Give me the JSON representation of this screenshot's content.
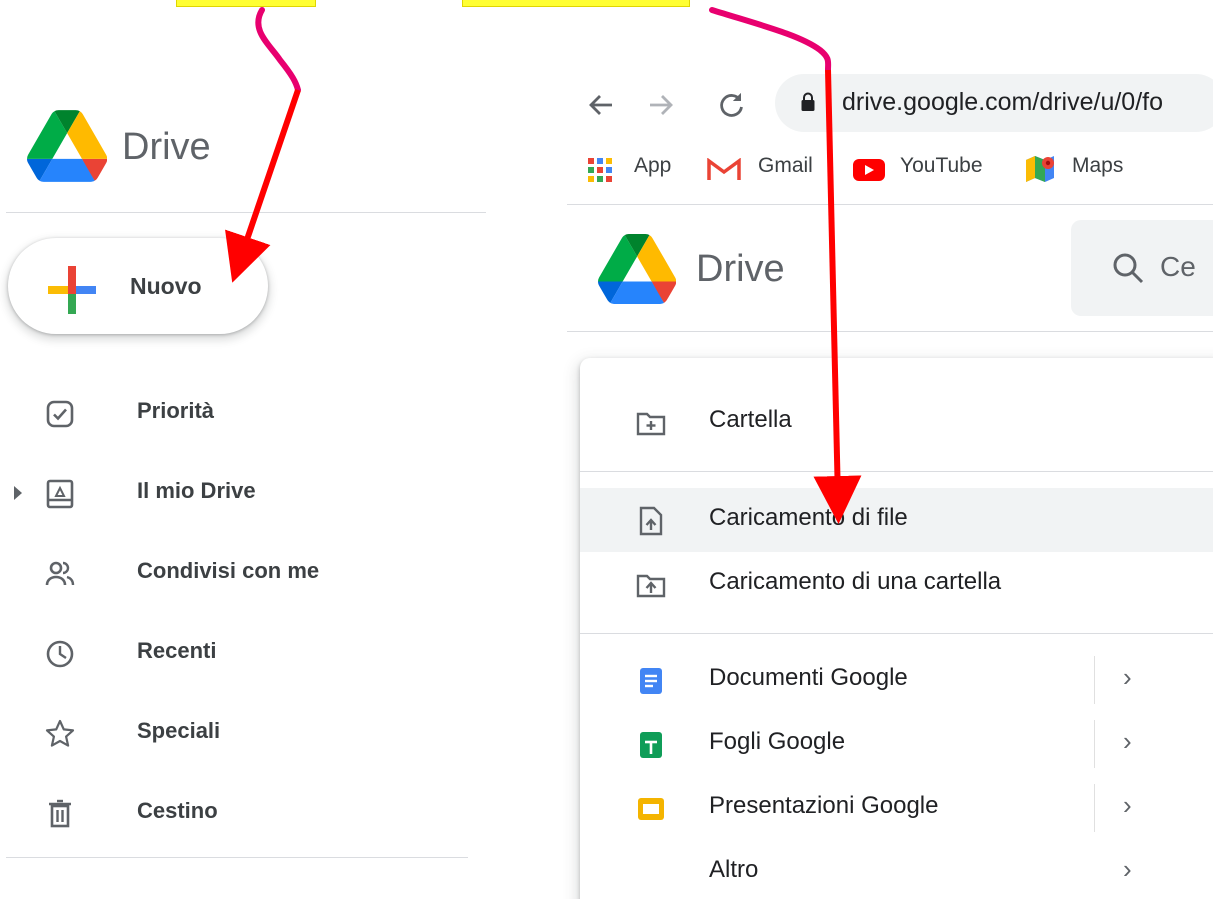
{
  "left": {
    "brand": "Drive",
    "new_button": "Nuovo",
    "nav": [
      {
        "label": "Priorità",
        "icon": "priority-icon"
      },
      {
        "label": "Il mio Drive",
        "icon": "my-drive-icon"
      },
      {
        "label": "Condivisi con me",
        "icon": "shared-icon"
      },
      {
        "label": "Recenti",
        "icon": "clock-icon"
      },
      {
        "label": "Speciali",
        "icon": "star-icon"
      },
      {
        "label": "Cestino",
        "icon": "trash-icon"
      }
    ]
  },
  "browser": {
    "url": "drive.google.com/drive/u/0/fo",
    "bookmarks": [
      {
        "label": "App",
        "icon": "apps-grid-icon"
      },
      {
        "label": "Gmail",
        "icon": "gmail-icon"
      },
      {
        "label": "YouTube",
        "icon": "youtube-icon"
      },
      {
        "label": "Maps",
        "icon": "maps-icon"
      }
    ]
  },
  "right": {
    "brand": "Drive",
    "search_placeholder": "Ce",
    "menu": [
      {
        "label": "Cartella",
        "icon": "new-folder-icon"
      },
      {
        "label": "Caricamento di file",
        "icon": "file-upload-icon"
      },
      {
        "label": "Caricamento di una cartella",
        "icon": "folder-upload-icon"
      },
      {
        "label": "Documenti Google",
        "icon": "google-docs-icon"
      },
      {
        "label": "Fogli Google",
        "icon": "google-sheets-icon"
      },
      {
        "label": "Presentazioni Google",
        "icon": "google-slides-icon"
      },
      {
        "label": "Altro",
        "icon": "more-icon"
      }
    ],
    "chevron": "›"
  },
  "colors": {
    "annotation_arrow": "#ff0000",
    "annotation_curve": "#e8006f",
    "highlight": "#ffff33",
    "docs": "#4285f4",
    "sheets": "#0f9d58",
    "slides": "#f4b400"
  }
}
